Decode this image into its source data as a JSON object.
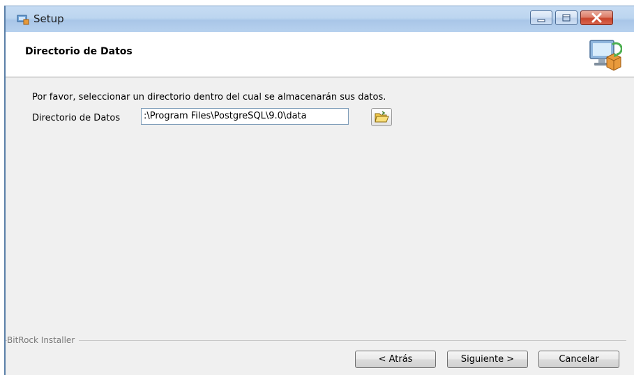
{
  "window": {
    "title": "Setup",
    "icons": {
      "app": "setup-app-icon",
      "header": "installer-monitor-icon",
      "browse": "folder-open-icon"
    }
  },
  "header": {
    "title": "Directorio de Datos"
  },
  "content": {
    "instruction": "Por favor, seleccionar un directorio dentro del cual se almacenarán sus datos.",
    "directory": {
      "label": "Directorio de Datos",
      "value": ":\\Program Files\\PostgreSQL\\9.0\\data"
    }
  },
  "footer": {
    "vendor": "BitRock Installer",
    "buttons": {
      "back": "< Atrás",
      "next": "Siguiente >",
      "cancel": "Cancelar"
    }
  },
  "colors": {
    "titlebar": "#bcd5ef",
    "close": "#c9442c",
    "content_bg": "#f0f0f0"
  }
}
